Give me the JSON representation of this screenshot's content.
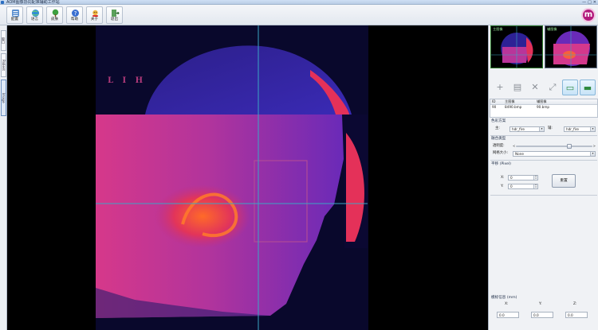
{
  "window": {
    "title": "AOM图像协同配准辅助工作站",
    "controls": [
      "—",
      "□",
      "✕"
    ]
  },
  "toolbar": {
    "buttons": [
      {
        "id": "config",
        "label": "配置",
        "icon": "sliders-icon"
      },
      {
        "id": "language",
        "label": "语言",
        "icon": "globe-icon"
      },
      {
        "id": "skin",
        "label": "皮肤",
        "icon": "tree-icon"
      },
      {
        "id": "help",
        "label": "帮助",
        "icon": "help-icon"
      },
      {
        "id": "about",
        "label": "关于",
        "icon": "about-icon"
      },
      {
        "id": "exit",
        "label": "退出",
        "icon": "exit-icon"
      }
    ],
    "logo_text": "m"
  },
  "left_tabs": [
    "窗口",
    "Patient",
    "Image"
  ],
  "viewer": {
    "label": "L I H",
    "crosshair_color": "#3aa6c4",
    "roi_color": "#b04a98"
  },
  "panel": {
    "thumbnails": [
      {
        "label": "主图像"
      },
      {
        "label": "辅图像"
      }
    ],
    "file_table": {
      "headers": [
        "ID",
        "主图像",
        "辅图像"
      ],
      "rows": [
        {
          "id": "90",
          "primary": "8490.bmp",
          "secondary": "90.bmp"
        }
      ]
    },
    "color_scheme": {
      "title": "色彩方案",
      "primary_label": "主:",
      "primary_value": "hdr_fire",
      "secondary_label": "辅:",
      "secondary_value": "hdr_fire"
    },
    "fusion": {
      "title": "融合类型",
      "opacity_label": "透明度:",
      "opacity_lt": "<",
      "opacity_gt": ">",
      "opacity_value": 0.7,
      "grid_label": "网格大小:",
      "grid_value": "None"
    },
    "shift": {
      "title": "平移 (Pixel)",
      "x_label": "X:",
      "x_value": "0",
      "y_label": "Y:",
      "y_value": "0",
      "reset_label": "重置"
    },
    "coords": {
      "title": "模标信息 (mm)",
      "x_label": "X:",
      "y_label": "Y:",
      "z_label": "Z:",
      "x_value": "0.0",
      "y_value": "0.0",
      "z_value": "0.0"
    }
  },
  "colors": {
    "accent": "#b21a7c",
    "highlight": "#c7e3f7"
  }
}
